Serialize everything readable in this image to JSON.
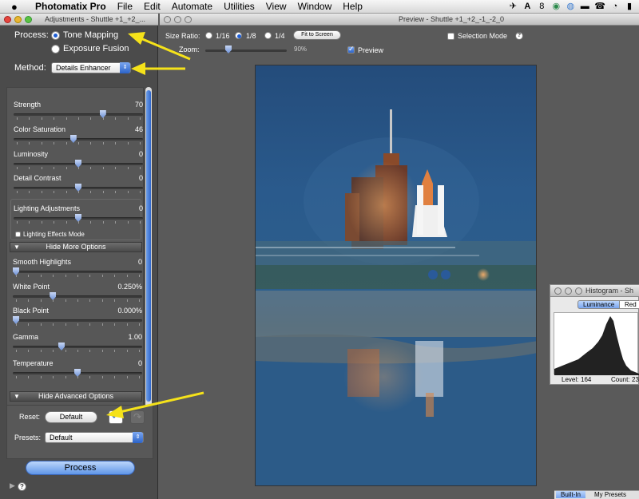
{
  "menubar": {
    "app": "Photomatix Pro",
    "items": [
      "File",
      "Edit",
      "Automate",
      "Utilities",
      "View",
      "Window",
      "Help"
    ],
    "status_badge": "8"
  },
  "adjustments": {
    "window_title": "Adjustments - Shuttle +1_+2_...",
    "process_label": "Process:",
    "process_options": [
      "Tone Mapping",
      "Exposure Fusion"
    ],
    "method_label": "Method:",
    "method_value": "Details Enhancer",
    "sliders": [
      {
        "label": "Strength",
        "value": "70",
        "pos": 0.7
      },
      {
        "label": "Color Saturation",
        "value": "46",
        "pos": 0.46
      },
      {
        "label": "Luminosity",
        "value": "0",
        "pos": 0.5
      },
      {
        "label": "Detail Contrast",
        "value": "0",
        "pos": 0.5
      }
    ],
    "lighting": {
      "label": "Lighting Adjustments",
      "value": "0",
      "pos": 0.5,
      "checkbox": "Lighting Effects Mode"
    },
    "more_options": {
      "header": "Hide More Options",
      "sliders": [
        {
          "label": "Smooth Highlights",
          "value": "0",
          "pos": 0.0
        },
        {
          "label": "White Point",
          "value": "0.250%",
          "pos": 0.3
        },
        {
          "label": "Black Point",
          "value": "0.000%",
          "pos": 0.0
        },
        {
          "label": "Gamma",
          "value": "1.00",
          "pos": 0.37
        },
        {
          "label": "Temperature",
          "value": "0",
          "pos": 0.5
        }
      ]
    },
    "advanced_header": "Hide Advanced Options",
    "reset_label": "Reset:",
    "default_button": "Default",
    "presets_label": "Presets:",
    "presets_value": "Default",
    "process_button": "Process",
    "help": "?"
  },
  "preview": {
    "window_title": "Preview - Shuttle +1_+2_-1_-2_0",
    "size_ratio_label": "Size Ratio:",
    "size_options": [
      "1/16",
      "1/8",
      "1/4"
    ],
    "fit_button": "Fit to Screen",
    "zoom_label": "Zoom:",
    "zoom_value": "90%",
    "selection_mode": "Selection Mode",
    "preview_label": "Preview",
    "help": "?"
  },
  "histogram": {
    "window_title": "Histogram - Sh",
    "tabs": [
      "Luminance",
      "Red"
    ],
    "level_label": "Level:",
    "level_value": "164",
    "count_label": "Count:",
    "count_value": "23"
  },
  "bottom_tabs": [
    "Built-In",
    "My Presets"
  ]
}
